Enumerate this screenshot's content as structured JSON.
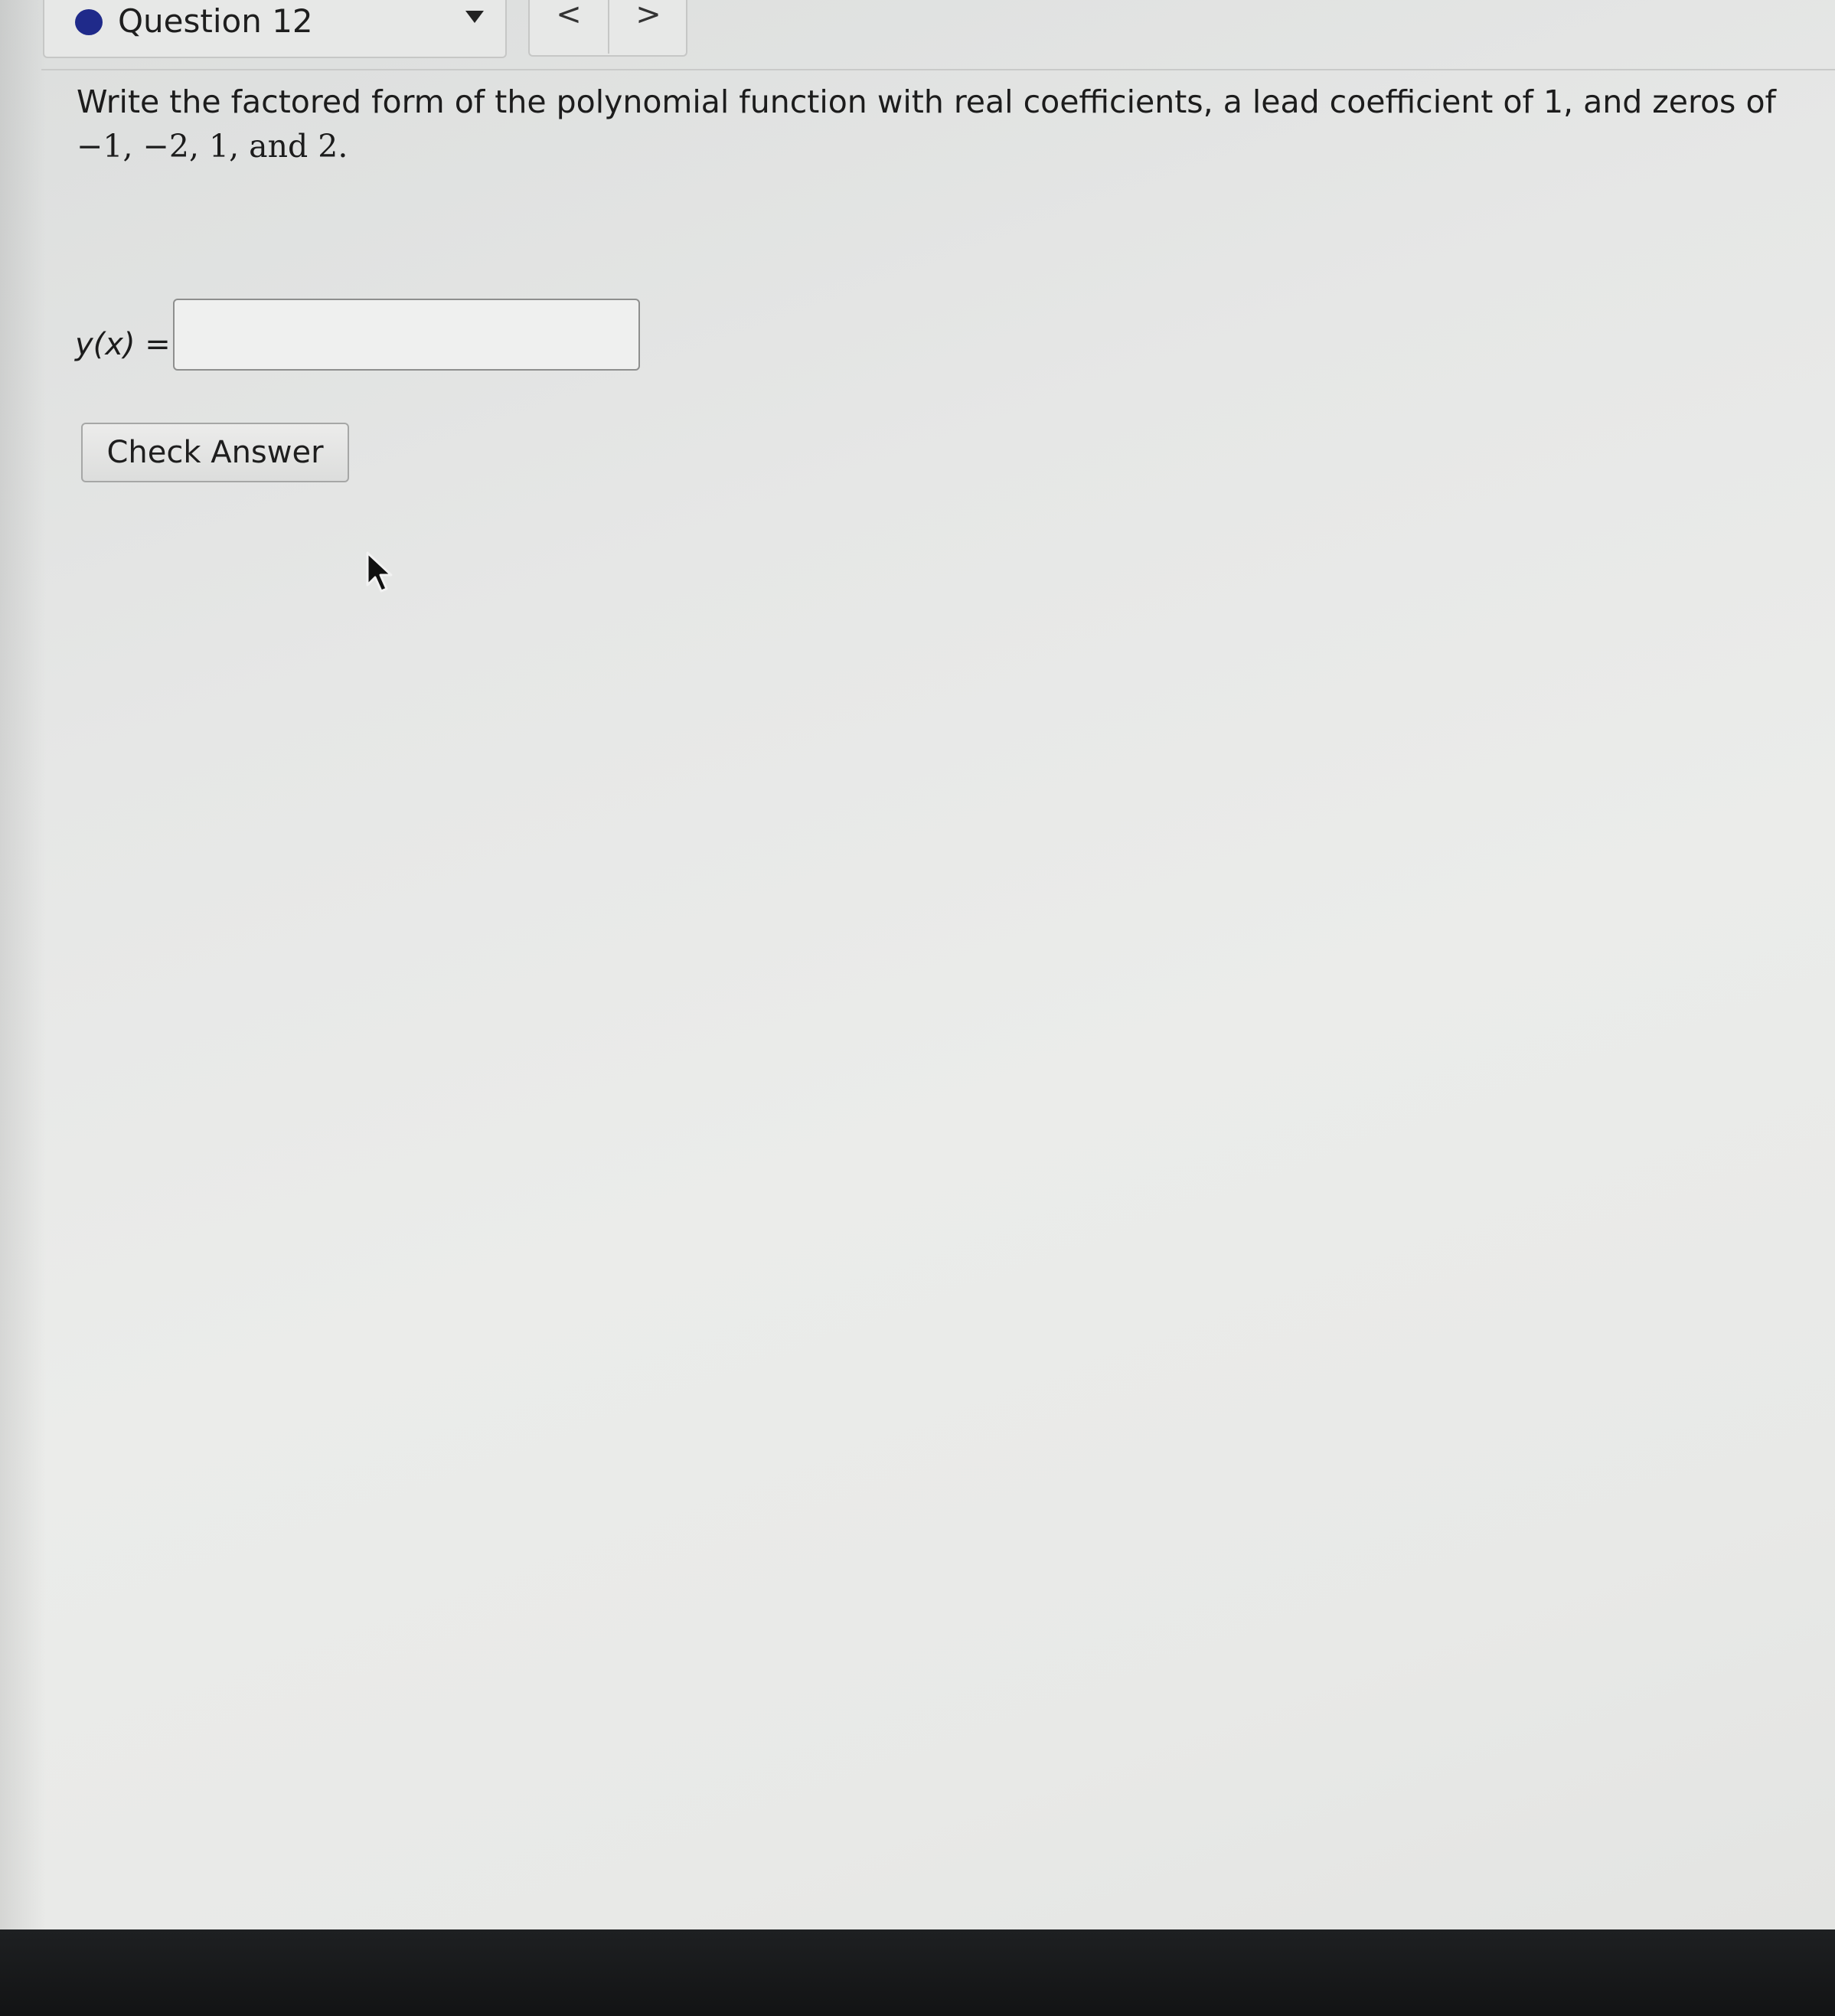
{
  "header": {
    "question_title": "Question 12",
    "prev_label": "<",
    "next_label": ">"
  },
  "question": {
    "prompt_line1": "Write the factored form of the polynomial function with real coefficients, a lead coefficient of 1, and zeros of",
    "prompt_line2": "−1, −2, 1, and 2."
  },
  "answer": {
    "label_fn": "y(x)",
    "label_eq": " =",
    "value": "",
    "placeholder": ""
  },
  "actions": {
    "check_label": "Check Answer"
  },
  "colors": {
    "status_dot": "#1f2a8a",
    "background": "#e6e7e6",
    "bezel": "#141516"
  }
}
